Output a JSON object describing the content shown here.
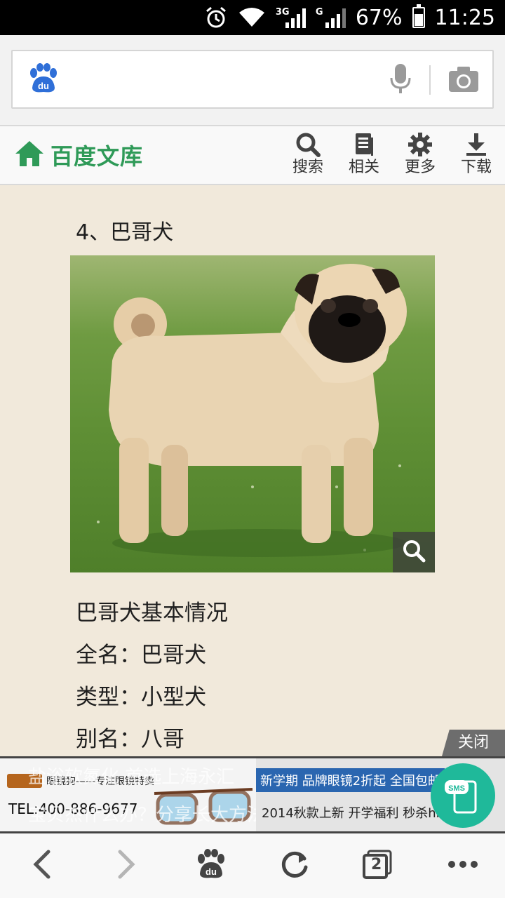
{
  "status_bar": {
    "network_3g": "3G",
    "network_g": "G",
    "battery": "67%",
    "time": "11:25"
  },
  "browser": {
    "search_placeholder": ""
  },
  "toolbar": {
    "brand": "百度文库",
    "buttons": [
      {
        "label": "搜索",
        "icon": "search-icon"
      },
      {
        "label": "相关",
        "icon": "document-icon"
      },
      {
        "label": "更多",
        "icon": "gear-icon"
      },
      {
        "label": "下载",
        "icon": "download-icon"
      }
    ]
  },
  "document": {
    "heading": "4、巴哥犬",
    "paragraphs": [
      "巴哥犬基本情况",
      "全名：巴哥犬",
      "类型：小型犬",
      "别名：八哥"
    ]
  },
  "ad": {
    "close_label": "关闭",
    "brand_text": "眼镜狗——专注眼镜特卖",
    "tel": "TEL:400-886-9677",
    "overlay_top": "盐浴软氮化 首选上海永汇",
    "overlay_bottom": "宝贝杰什么办？分享长大方法",
    "right_top": "新学期 品牌眼镜2折起 全国包邮",
    "right_bottom": "2014秋款上新 开学福利 秒杀hi",
    "sms_label": "SMS"
  },
  "bottom_nav": {
    "tabs_count": "2"
  },
  "colors": {
    "brand_green": "#2f9a58",
    "page_bg": "#f1e9db",
    "sms_teal": "#1fb99a"
  }
}
